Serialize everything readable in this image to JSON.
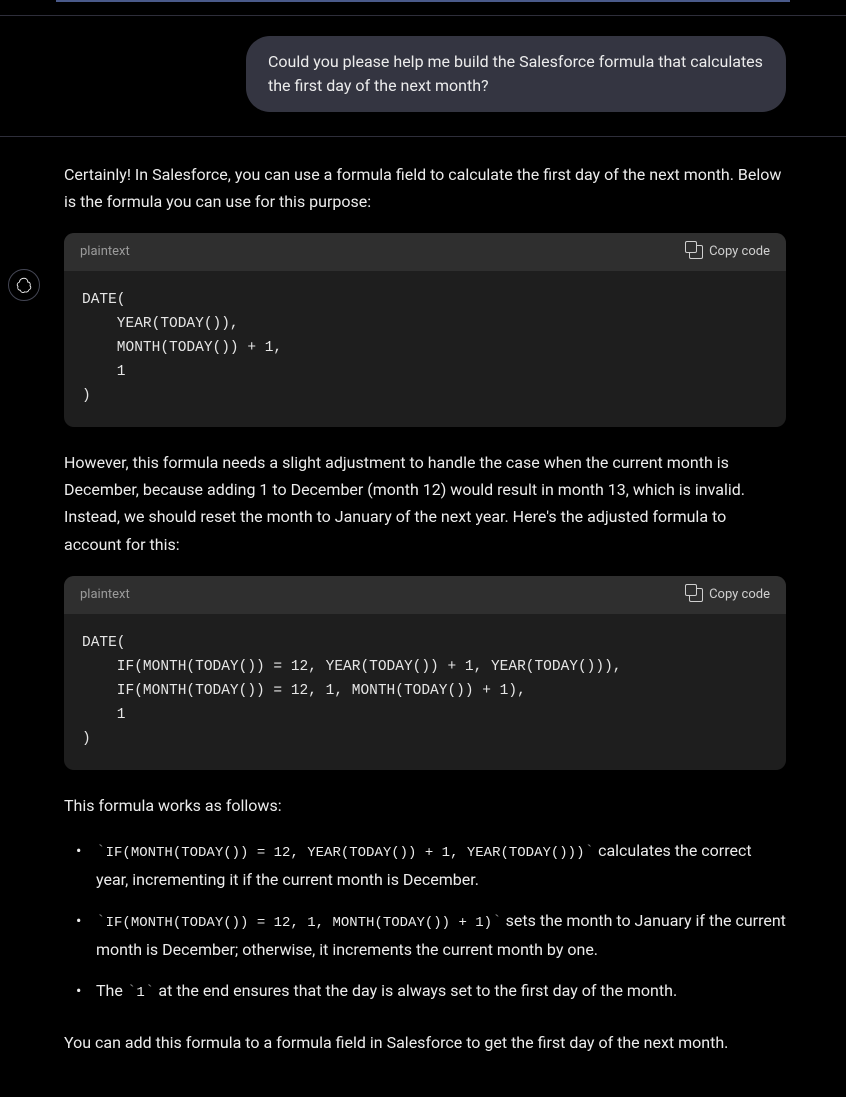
{
  "user": {
    "message": "Could you please help me build the Salesforce formula that calculates the first day of the next month?"
  },
  "assistant": {
    "intro": "Certainly! In Salesforce, you can use a formula field to calculate the first day of the next month. Below is the formula you can use for this purpose:",
    "code1": {
      "lang": "plaintext",
      "copy_label": "Copy code",
      "content": "DATE(\n    YEAR(TODAY()),\n    MONTH(TODAY()) + 1,\n    1\n)"
    },
    "adjust_note": "However, this formula needs a slight adjustment to handle the case when the current month is December, because adding 1 to December (month 12) would result in month 13, which is invalid. Instead, we should reset the month to January of the next year. Here's the adjusted formula to account for this:",
    "code2": {
      "lang": "plaintext",
      "copy_label": "Copy code",
      "content": "DATE(\n    IF(MONTH(TODAY()) = 12, YEAR(TODAY()) + 1, YEAR(TODAY())),\n    IF(MONTH(TODAY()) = 12, 1, MONTH(TODAY()) + 1),\n    1\n)"
    },
    "works_intro": "This formula works as follows:",
    "bullets": {
      "b1_code": "IF(MONTH(TODAY()) = 12, YEAR(TODAY()) + 1, YEAR(TODAY()))",
      "b1_text": " calculates the correct year, incrementing it if the current month is December.",
      "b2_code": "IF(MONTH(TODAY()) = 12, 1, MONTH(TODAY()) + 1)",
      "b2_text": " sets the month to January if the current month is December; otherwise, it increments the current month by one.",
      "b3_pre": "The ",
      "b3_code": "1",
      "b3_text": " at the end ensures that the day is always set to the first day of the month."
    },
    "outro": "You can add this formula to a formula field in Salesforce to get the first day of the next month."
  }
}
